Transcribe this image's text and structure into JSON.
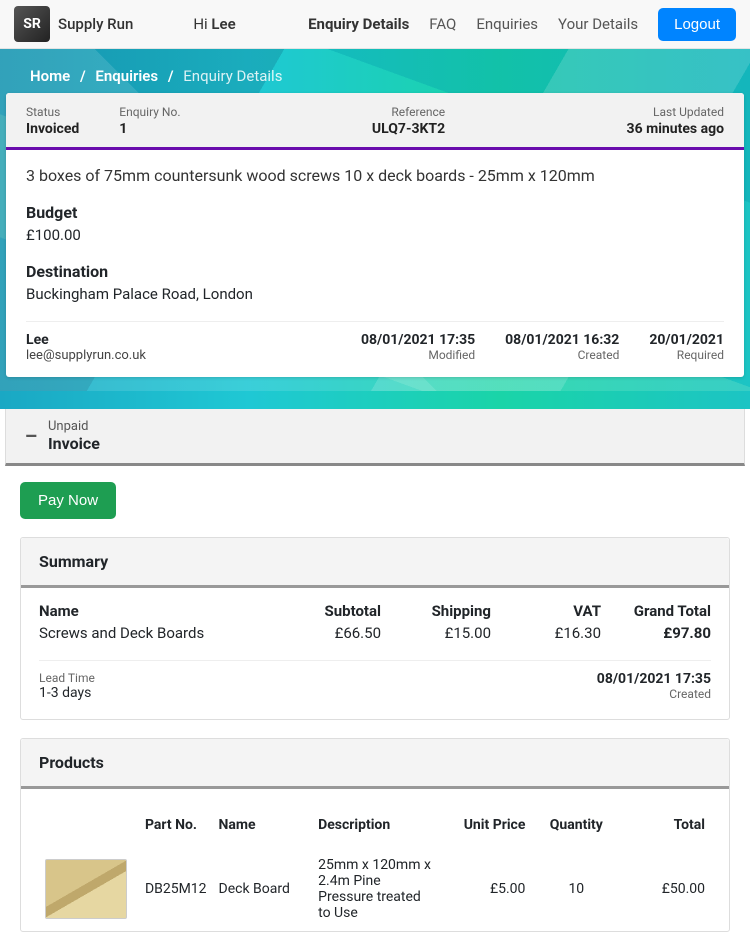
{
  "brand": {
    "logo_text": "SR",
    "name": "Supply Run"
  },
  "greeting": {
    "prefix": "Hi ",
    "name": "Lee"
  },
  "nav": {
    "enquiry_details": "Enquiry Details",
    "faq": "FAQ",
    "enquiries": "Enquiries",
    "your_details": "Your Details",
    "logout": "Logout",
    "active": "enquiry_details"
  },
  "breadcrumb": {
    "home": "Home",
    "enquiries": "Enquiries",
    "current": "Enquiry Details",
    "sep": "/"
  },
  "meta": {
    "status_label": "Status",
    "status_value": "Invoiced",
    "enquiry_no_label": "Enquiry No.",
    "enquiry_no_value": "1",
    "reference_label": "Reference",
    "reference_value": "ULQ7-3KT2",
    "last_updated_label": "Last Updated",
    "last_updated_value": "36 minutes ago"
  },
  "enquiry": {
    "description": "3 boxes of 75mm countersunk wood screws 10 x deck boards - 25mm x 120mm",
    "budget_label": "Budget",
    "budget_value": "£100.00",
    "destination_label": "Destination",
    "destination_value": "Buckingham Palace Road, London",
    "contact_name": "Lee",
    "contact_email": "lee@supplyrun.co.uk",
    "modified": {
      "ts": "08/01/2021 17:35",
      "label": "Modified"
    },
    "created": {
      "ts": "08/01/2021 16:32",
      "label": "Created"
    },
    "required": {
      "ts": "20/01/2021",
      "label": "Required"
    }
  },
  "invoice_header": {
    "unpaid": "Unpaid",
    "title": "Invoice"
  },
  "actions": {
    "pay_now": "Pay Now"
  },
  "summary": {
    "panel_title": "Summary",
    "name_label": "Name",
    "name_value": "Screws and Deck Boards",
    "subtotal_label": "Subtotal",
    "subtotal_value": "£66.50",
    "shipping_label": "Shipping",
    "shipping_value": "£15.00",
    "vat_label": "VAT",
    "vat_value": "£16.30",
    "grand_label": "Grand Total",
    "grand_value": "£97.80",
    "lead_time_label": "Lead Time",
    "lead_time_value": "1-3 days",
    "created_ts": "08/01/2021 17:35",
    "created_label": "Created"
  },
  "products": {
    "panel_title": "Products",
    "headers": {
      "part_no": "Part No.",
      "name": "Name",
      "description": "Description",
      "unit_price": "Unit Price",
      "quantity": "Quantity",
      "total": "Total"
    },
    "rows": [
      {
        "part_no": "DB25M12",
        "name": "Deck Board",
        "description": "25mm x 120mm x 2.4m Pine Pressure treated to Use",
        "unit_price": "£5.00",
        "quantity": "10",
        "total": "£50.00"
      }
    ]
  }
}
